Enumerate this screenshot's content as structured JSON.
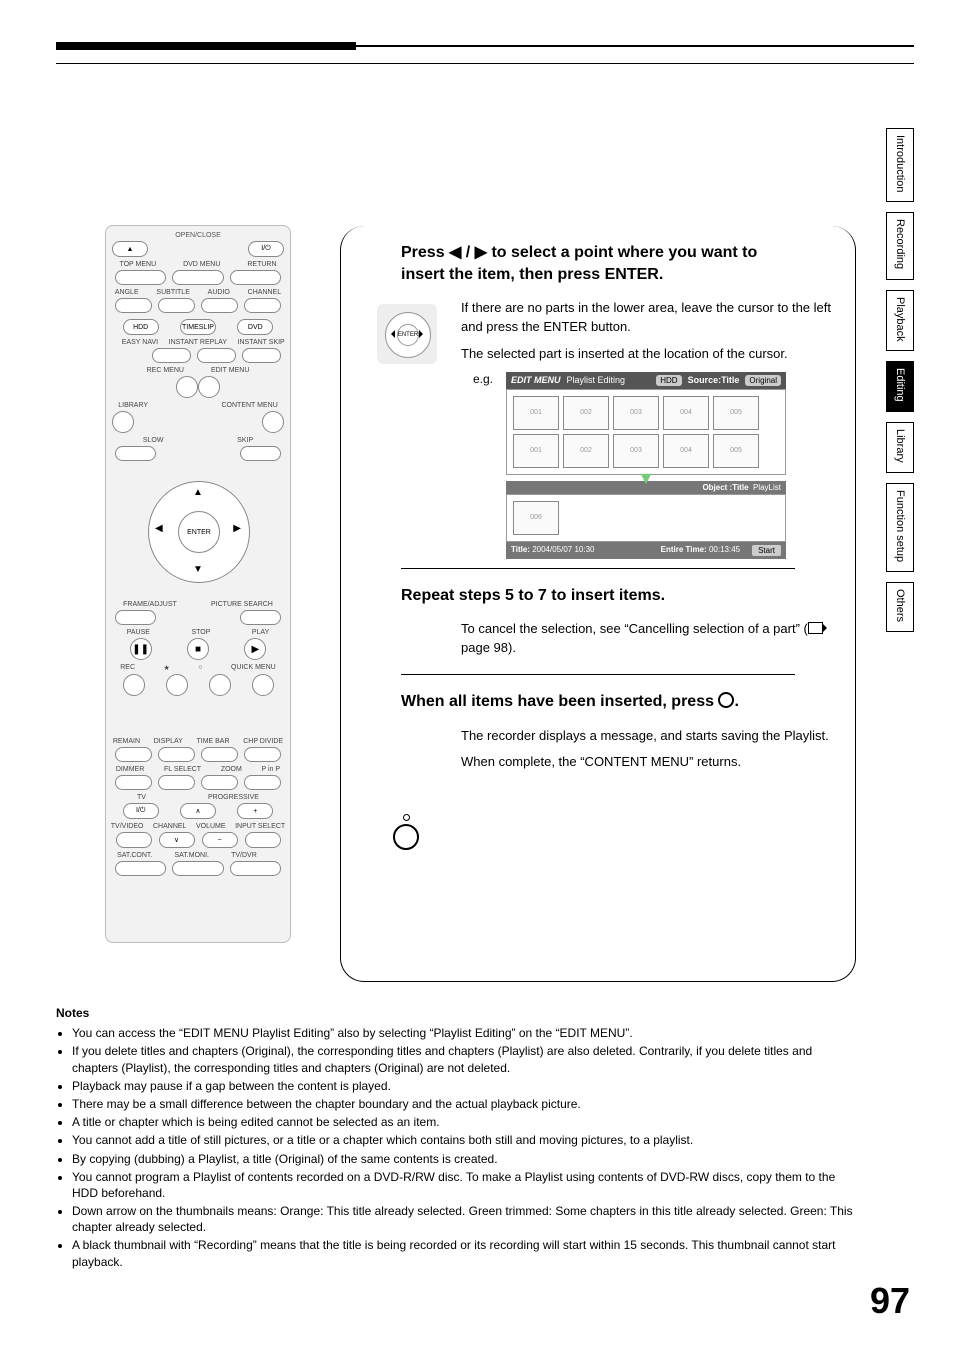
{
  "sidetabs": [
    "Introduction",
    "Recording",
    "Playback",
    "Editing",
    "Library",
    "Function setup",
    "Others"
  ],
  "active_tab": "Editing",
  "remote": {
    "row1": [
      "OPEN/CLOSE",
      "",
      "I/⏻"
    ],
    "row2_hdr": [
      "TOP MENU",
      "DVD MENU",
      "RETURN"
    ],
    "row3_hdr": [
      "ANGLE",
      "SUBTITLE",
      "AUDIO",
      "CHANNEL"
    ],
    "row4": [
      "HDD",
      "TIMESLIP",
      "DVD"
    ],
    "row5_hdr": [
      "",
      "EASY NAVI",
      "INSTANT REPLAY",
      "INSTANT SKIP"
    ],
    "row6_hdr": [
      "",
      "REC MENU",
      "EDIT MENU",
      ""
    ],
    "row7_hdr": [
      "LIBRARY",
      "",
      "",
      "CONTENT MENU"
    ],
    "skip": [
      "SLOW",
      "SKIP"
    ],
    "enter": "ENTER",
    "arcs": [
      "FRAME/ADJUST",
      "PICTURE SEARCH"
    ],
    "row8_hdr": [
      "PAUSE",
      "STOP",
      "PLAY"
    ],
    "row9_hdr": [
      "REC",
      "★",
      "○",
      "QUICK MENU"
    ],
    "row10_hdr": [
      "REMAIN",
      "DISPLAY",
      "TIME BAR",
      "CHP DIVIDE"
    ],
    "row11_hdr": [
      "DIMMER",
      "FL SELECT",
      "ZOOM",
      "P in P"
    ],
    "tv": "TV",
    "prog": "PROGRESSIVE",
    "row12": [
      "I/⏻",
      "∧",
      "+"
    ],
    "row13_hdr": [
      "TV/VIDEO",
      "CHANNEL",
      "VOLUME",
      "INPUT SELECT"
    ],
    "row13": [
      "",
      "∨",
      "−",
      ""
    ],
    "row14_hdr": [
      "SAT.CONT.",
      "SAT.MONI.",
      "TV/DVR",
      ""
    ]
  },
  "step1": {
    "title_pre": "Press ",
    "title_post": " to select a point where you want to insert the item, then press ENTER.",
    "p1": "If there are no parts in the lower area, leave the cursor to the left and press the ENTER button.",
    "p2": "The selected part is inserted at the location of the cursor.",
    "eg": "e.g.",
    "nav_enter": "ENTER"
  },
  "osd": {
    "menu": "EDIT MENU",
    "mode": "Playlist Editing",
    "drive": "HDD",
    "source": "Source:Title",
    "orig": "Original",
    "thumbs_top": [
      "001",
      "002",
      "003",
      "004",
      "005"
    ],
    "thumbs_bot": [
      "001",
      "002",
      "003",
      "004",
      "005"
    ],
    "obj": "Object :Title",
    "play": "PlayList",
    "thumb_single": "006",
    "ftr_title_lbl": "Title:",
    "ftr_title_val": "2004/05/07  10:30",
    "ftr_time_lbl": "Entire Time:",
    "ftr_time_val": "00:13:45",
    "start": "Start"
  },
  "step2": {
    "title": "Repeat steps 5 to 7 to insert items.",
    "p1_pre": "To cancel the selection, see “Cancelling selection of a part” (",
    "p1_post": " page 98)."
  },
  "step3": {
    "title_pre": "When all items have been inserted, press ",
    "title_post": ".",
    "p1": "The recorder displays a message, and starts saving the Playlist.",
    "p2": "When complete, the “CONTENT MENU” returns."
  },
  "notes_title": "Notes",
  "notes": [
    "You can access the “EDIT MENU Playlist Editing” also by selecting “Playlist Editing” on the “EDIT MENU”.",
    "If you delete titles and chapters (Original), the corresponding titles and chapters (Playlist) are also deleted. Contrarily, if you delete titles and chapters (Playlist), the corresponding titles and chapters (Original) are not deleted.",
    "Playback may pause if a gap between the content is played.",
    "There may be a small difference between the chapter boundary and the actual playback picture.",
    "A title or chapter which is being edited cannot be selected as an item.",
    "You cannot add a title of still pictures, or a title or a chapter which contains both still and moving pictures, to a playlist.",
    "By copying (dubbing) a Playlist, a title (Original) of the same contents is created.",
    "You cannot program a Playlist of contents recorded on a DVD-R/RW disc. To make a Playlist using contents of DVD-RW discs, copy them to the HDD beforehand.",
    "Down arrow on the thumbnails means: Orange: This title already selected. Green trimmed: Some chapters in this title already selected.  Green: This chapter already selected.",
    "A black thumbnail with “Recording” means that the title is being recorded or its recording will start within 15 seconds. This thumbnail cannot start playback."
  ],
  "page_number": "97"
}
